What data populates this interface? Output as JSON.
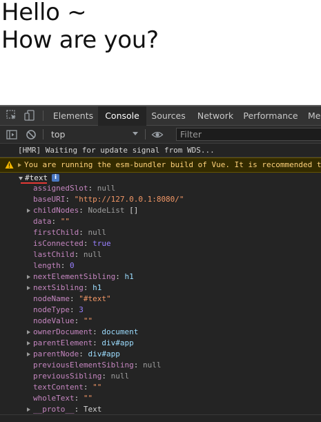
{
  "page": {
    "line1": "Hello ~",
    "line2": "How are you?"
  },
  "devtools": {
    "tabs": [
      {
        "label": "Elements"
      },
      {
        "label": "Console"
      },
      {
        "label": "Sources"
      },
      {
        "label": "Network"
      },
      {
        "label": "Performance"
      },
      {
        "label": "Me"
      }
    ],
    "active_tab": "Console",
    "toolbar": {
      "context": "top",
      "filter_placeholder": "Filter"
    }
  },
  "console": {
    "hmr_message": "[HMR] Waiting for update signal from WDS...",
    "warning_message": "You are running the esm-bundler build of Vue. It is recommended to",
    "object": {
      "label": "#text",
      "info_badge": "i",
      "properties": [
        {
          "key": "assignedSlot",
          "value": "null",
          "type": "null",
          "expandable": false
        },
        {
          "key": "baseURI",
          "value": "\"http://127.0.0.1:8080/\"",
          "type": "str",
          "expandable": false
        },
        {
          "key": "childNodes",
          "value": "NodeList",
          "extra": "[]",
          "type": "desc",
          "expandable": true
        },
        {
          "key": "data",
          "value": "\"\"",
          "type": "str",
          "expandable": false
        },
        {
          "key": "firstChild",
          "value": "null",
          "type": "null",
          "expandable": false
        },
        {
          "key": "isConnected",
          "value": "true",
          "type": "bool",
          "expandable": false
        },
        {
          "key": "lastChild",
          "value": "null",
          "type": "null",
          "expandable": false
        },
        {
          "key": "length",
          "value": "0",
          "type": "num",
          "expandable": false
        },
        {
          "key": "nextElementSibling",
          "value": "h1",
          "type": "obj",
          "expandable": true
        },
        {
          "key": "nextSibling",
          "value": "h1",
          "type": "obj",
          "expandable": true
        },
        {
          "key": "nodeName",
          "value": "\"#text\"",
          "type": "str",
          "expandable": false
        },
        {
          "key": "nodeType",
          "value": "3",
          "type": "num",
          "expandable": false
        },
        {
          "key": "nodeValue",
          "value": "\"\"",
          "type": "str",
          "expandable": false
        },
        {
          "key": "ownerDocument",
          "value": "document",
          "type": "obj",
          "expandable": true
        },
        {
          "key": "parentElement",
          "value": "div#app",
          "type": "obj",
          "expandable": true
        },
        {
          "key": "parentNode",
          "value": "div#app",
          "type": "obj",
          "expandable": true
        },
        {
          "key": "previousElementSibling",
          "value": "null",
          "type": "null",
          "expandable": false
        },
        {
          "key": "previousSibling",
          "value": "null",
          "type": "null",
          "expandable": false
        },
        {
          "key": "textContent",
          "value": "\"\"",
          "type": "str",
          "expandable": false
        },
        {
          "key": "wholeText",
          "value": "\"\"",
          "type": "str",
          "expandable": false
        },
        {
          "key": "__proto__",
          "value": "Text",
          "type": "plain",
          "expandable": true
        }
      ]
    }
  },
  "colors": {
    "devtools_bg": "#242424",
    "warning_bg": "#332b00",
    "warning_text": "#ffd27a",
    "key": "#c586c0",
    "string": "#f29766",
    "number": "#9980ff",
    "highlight_underline": "#e53935"
  },
  "icons": {
    "inspect": "inspect-element-icon",
    "device": "device-toolbar-icon",
    "sidebar": "console-sidebar-icon",
    "clear": "clear-console-icon",
    "eye": "live-expression-icon",
    "warning": "warning-triangle-icon"
  }
}
